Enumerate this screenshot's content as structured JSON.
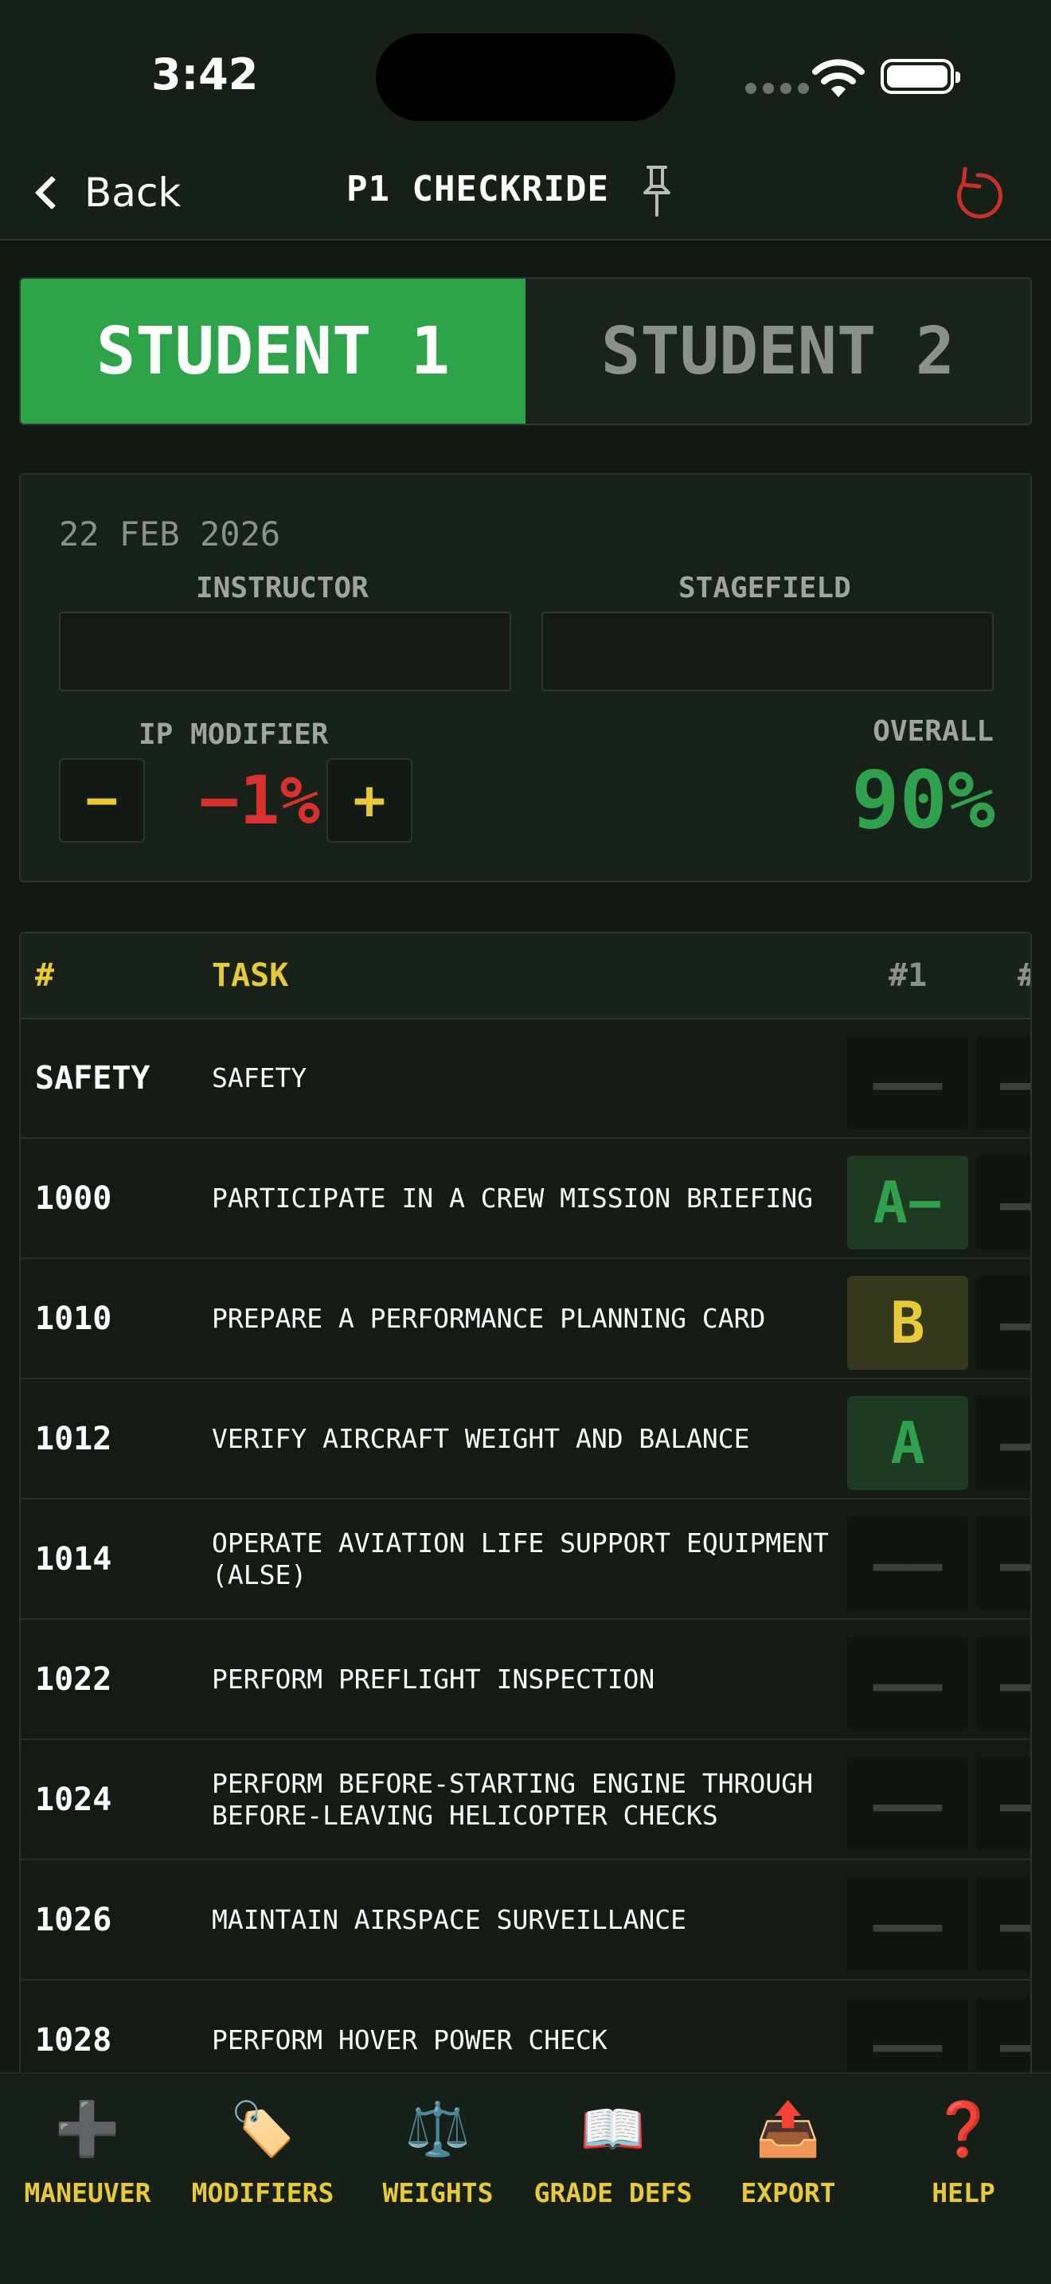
{
  "status": {
    "time": "3:42"
  },
  "nav": {
    "back_label": "Back",
    "title": "P1 CHECKRIDE"
  },
  "students": [
    {
      "label": "STUDENT 1",
      "active": true
    },
    {
      "label": "STUDENT 2",
      "active": false
    }
  ],
  "info": {
    "date": "22 FEB 2026",
    "instructor_label": "INSTRUCTOR",
    "instructor_value": "",
    "stagefield_label": "STAGEFIELD",
    "stagefield_value": "",
    "ip_modifier_label": "IP MODIFIER",
    "ip_minus": "−",
    "ip_value": "−1%",
    "ip_plus": "+",
    "overall_label": "OVERALL",
    "overall_value": "90%"
  },
  "table": {
    "headers": {
      "num": "#",
      "task": "TASK",
      "g1": "#1",
      "g2": "#"
    },
    "rows": [
      {
        "num": "SAFETY",
        "task": "SAFETY",
        "g1": "——",
        "g2": "—",
        "g1_color": "none"
      },
      {
        "num": "1000",
        "task": "PARTICIPATE IN A CREW MISSION BRIEFING",
        "g1": "A−",
        "g2": "—",
        "g1_color": "green"
      },
      {
        "num": "1010",
        "task": "PREPARE A PERFORMANCE PLANNING CARD",
        "g1": "B",
        "g2": "—",
        "g1_color": "yellow"
      },
      {
        "num": "1012",
        "task": "VERIFY AIRCRAFT WEIGHT AND BALANCE",
        "g1": "A",
        "g2": "—",
        "g1_color": "green"
      },
      {
        "num": "1014",
        "task": "OPERATE AVIATION LIFE SUPPORT EQUIPMENT (ALSE)",
        "g1": "——",
        "g2": "—",
        "g1_color": "none"
      },
      {
        "num": "1022",
        "task": "PERFORM PREFLIGHT INSPECTION",
        "g1": "——",
        "g2": "—",
        "g1_color": "none"
      },
      {
        "num": "1024",
        "task": "PERFORM BEFORE-STARTING ENGINE THROUGH BEFORE-LEAVING HELICOPTER CHECKS",
        "g1": "——",
        "g2": "—",
        "g1_color": "none"
      },
      {
        "num": "1026",
        "task": "MAINTAIN AIRSPACE SURVEILLANCE",
        "g1": "——",
        "g2": "—",
        "g1_color": "none"
      },
      {
        "num": "1028",
        "task": "PERFORM HOVER POWER CHECK",
        "g1": "——",
        "g2": "—",
        "g1_color": "none"
      }
    ]
  },
  "toolbar": [
    {
      "label": "MANEUVER",
      "icon": "➕",
      "icon_name": "plus-icon",
      "icon_color": "#555b55"
    },
    {
      "label": "MODIFIERS",
      "icon": "🏷️",
      "icon_name": "tag-icon",
      "icon_color": "#f3c9a0"
    },
    {
      "label": "WEIGHTS",
      "icon": "⚖️",
      "icon_name": "scale-icon",
      "icon_color": "#b8bcb8"
    },
    {
      "label": "GRADE DEFS",
      "icon": "📖",
      "icon_name": "book-icon",
      "icon_color": "#cfe3f2"
    },
    {
      "label": "EXPORT",
      "icon": "📤",
      "icon_name": "outbox-tray-icon",
      "icon_color": "#3a8bd8"
    },
    {
      "label": "HELP",
      "icon": "❓",
      "icon_name": "question-mark-icon",
      "icon_color": "#e0242a"
    }
  ]
}
